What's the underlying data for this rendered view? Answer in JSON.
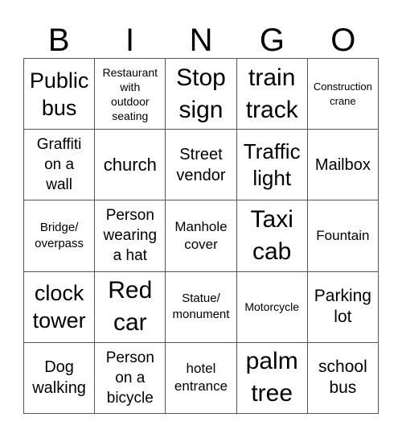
{
  "header": {
    "letters": [
      "B",
      "I",
      "N",
      "G",
      "O"
    ]
  },
  "board": {
    "rows": [
      [
        "Public\nbus",
        "Restaurant\nwith\noutdoor\nseating",
        "Stop\nsign",
        "train\ntrack",
        "Construction\ncrane"
      ],
      [
        "Graffiti\non a\nwall",
        "church",
        "Street\nvendor",
        "Traffic\nlight",
        "Mailbox"
      ],
      [
        "Bridge/\noverpass",
        "Person\nwearing\na hat",
        "Manhole\ncover",
        "Taxi\ncab",
        "Fountain"
      ],
      [
        "clock\ntower",
        "Red\ncar",
        "Statue/\nmonument",
        "Motorcycle",
        "Parking\nlot"
      ],
      [
        "Dog\nwalking",
        "Person\non a\nbicycle",
        "hotel\nentrance",
        "palm\ntree",
        "school\nbus"
      ]
    ]
  },
  "colors": {
    "grid_line": "#555555",
    "text": "#000000",
    "background": "#ffffff"
  }
}
